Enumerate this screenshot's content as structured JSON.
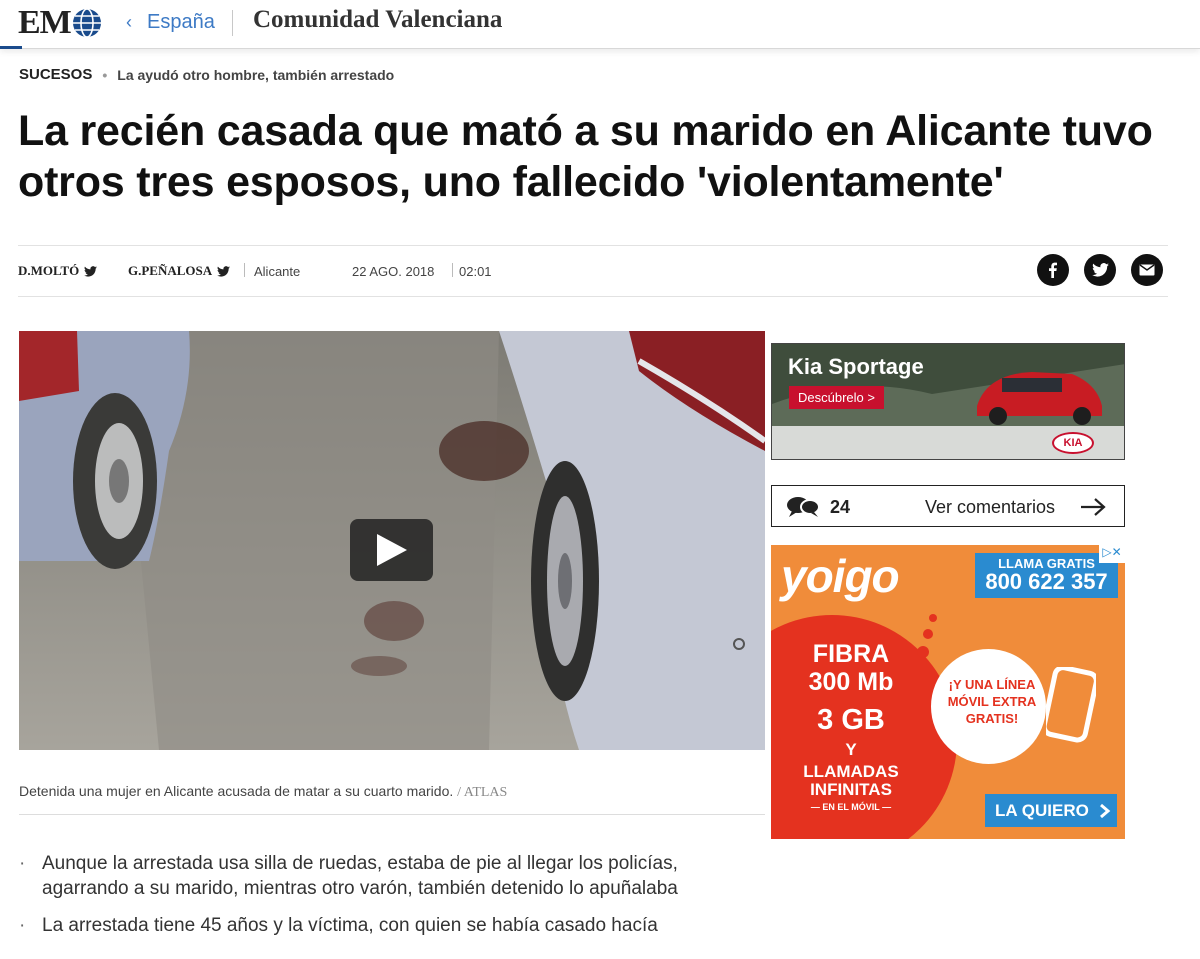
{
  "header": {
    "logo_text": "EM",
    "back_icon": "chevron-left-icon",
    "breadcrumb": "España",
    "section": "Comunidad Valenciana",
    "accent_color": "#1a4b8c",
    "link_color": "#3d7ac5"
  },
  "article": {
    "kicker": "SUCESOS",
    "kicker_separator": "•",
    "kicker_sub": "La ayudó otro hombre, también arrestado",
    "headline": "La recién casada que mató a su marido en Alicante tuvo otros tres esposos, uno fallecido 'violentamente'",
    "byline": {
      "author1": "D.MOLTÓ",
      "author2": "G.PEÑALOSA",
      "location": "Alicante",
      "date": "22 AGO. 2018",
      "time": "02:01"
    },
    "share_icons": [
      "facebook-icon",
      "twitter-icon",
      "email-icon"
    ],
    "caption": "Detenida una mujer en Alicante acusada de matar a su cuarto marido.",
    "caption_credit": "/ ATLAS",
    "bullets": [
      "Aunque la arrestada usa silla de ruedas, estaba de pie al llegar los policías, agarrando a su marido, mientras otro varón, también detenido lo apuñalaba",
      "La arrestada tiene 45 años y la víctima, con quien se había casado hacía"
    ]
  },
  "ads": {
    "kia": {
      "title": "Kia Sportage",
      "button": "Descúbrelo >",
      "brand": "KIA",
      "accent_color": "#c8102e"
    },
    "comments": {
      "count": "24",
      "label": "Ver comentarios"
    },
    "yoigo": {
      "brand": "yoigo",
      "call_label": "LLAMA GRATIS",
      "phone": "800 622 357",
      "fibra": "FIBRA",
      "speed": "300 Mb",
      "data": "3 GB",
      "y": "Y",
      "calls": "LLAMADAS INFINITAS",
      "mobile": "— EN EL MÓVIL —",
      "promo": "¡Y UNA LÍNEA MÓVIL EXTRA GRATIS!",
      "cta": "LA QUIERO",
      "orange": "#f08c3a",
      "red": "#e4321f",
      "blue": "#2a8bd0"
    }
  }
}
